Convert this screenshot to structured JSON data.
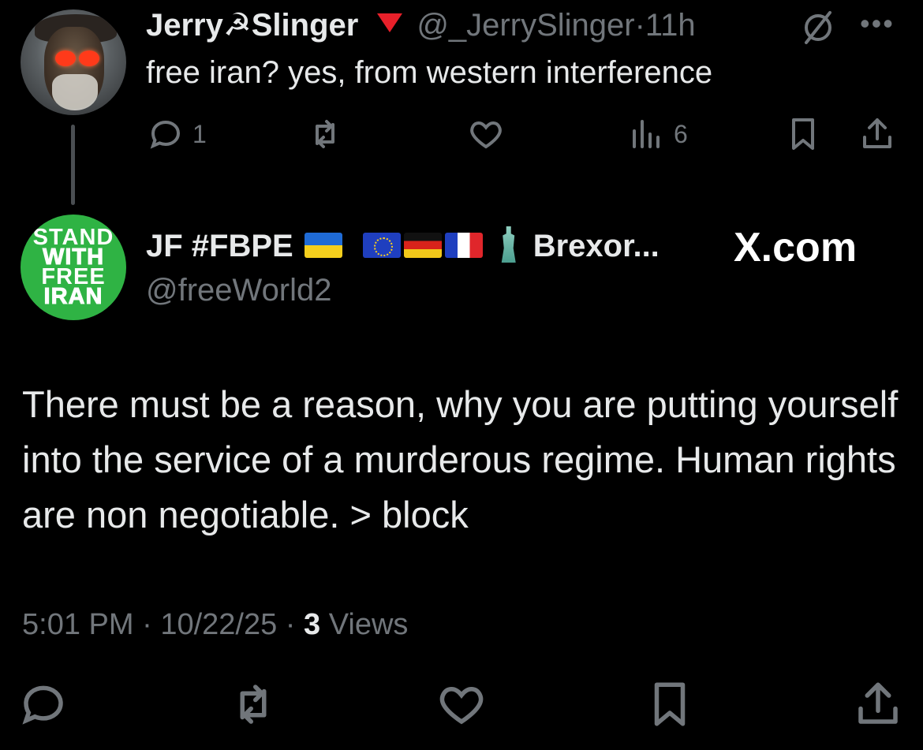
{
  "parent_tweet": {
    "display_name": "Jerry☭Slinger",
    "handle": "@_JerrySlinger",
    "separator": "·",
    "time_ago": "11h",
    "text": "free iran? yes, from western interference",
    "actions": {
      "reply_count": "1",
      "views_count": "6"
    }
  },
  "reply_tweet": {
    "display_name": "JF #FBPE",
    "name_suffix": "Brexor...",
    "handle": "@freeWorld2",
    "avatar_text": [
      "STAND",
      "WITH",
      "FREE",
      "IRAN"
    ],
    "text": "There must be a reason, why you are putting yourself into the service of a murderous regime. Human rights are non negotiable. > block",
    "time": "5:01 PM",
    "date": "10/22/25",
    "separator": "·",
    "views_count": "3",
    "views_label": "Views"
  },
  "watermark": "X.com",
  "icons": {
    "grok": "grok-icon",
    "more": "more-icon",
    "reply": "reply-icon",
    "retweet": "retweet-icon",
    "like": "like-icon",
    "views": "views-icon",
    "bookmark": "bookmark-icon",
    "share": "share-icon"
  },
  "colors": {
    "background": "#000000",
    "text_primary": "#e7e9ea",
    "text_secondary": "#71767b",
    "triangle": "#e8202a",
    "avatar_green": "#2fb344"
  }
}
